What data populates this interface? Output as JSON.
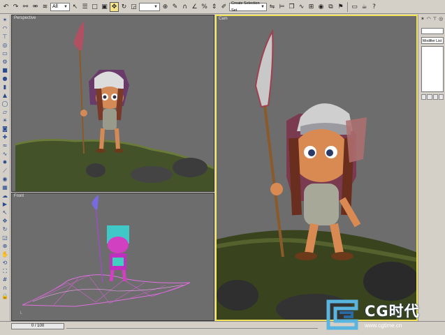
{
  "toolbar": {
    "selection_filter": "All",
    "named_selection": "Create Selection Set",
    "icons": [
      "undo-icon",
      "redo-icon",
      "link-icon",
      "unlink-icon",
      "bind-spacewarp-icon",
      "selection-filter",
      "select-object-icon",
      "select-by-name-icon",
      "rect-region-icon",
      "window-crossing-icon",
      "select-move-icon",
      "select-rotate-icon",
      "select-scale-icon",
      "reference-coord",
      "pivot-icon",
      "manipulate-icon",
      "snap-icon",
      "angle-snap-icon",
      "percent-snap-icon",
      "spinner-snap-icon",
      "named-selection",
      "mirror-icon",
      "align-icon",
      "layer-icon",
      "curve-editor-icon",
      "schematic-icon",
      "material-editor-icon",
      "render-scene-icon",
      "quick-render-icon",
      "render-type-icon",
      "teapot-icon"
    ]
  },
  "left_toolbar": {
    "icons": [
      "create-icon",
      "modify-icon",
      "hierarchy-icon",
      "motion-icon",
      "display-icon",
      "utilities-icon",
      "box-icon",
      "sphere-icon",
      "cylinder-icon",
      "cone-icon",
      "torus-icon",
      "plane-icon",
      "light-icon",
      "camera-icon",
      "helper-icon",
      "spacewarp-icon",
      "shape-icon",
      "particle-icon",
      "bone-icon",
      "material-icon",
      "render-icon",
      "environment-icon",
      "video-post-icon",
      "select-icon",
      "move-icon",
      "rotate-icon",
      "scale-icon",
      "zoom-icon",
      "pan-icon",
      "orbit-icon",
      "maximize-icon",
      "grid-icon",
      "snap-icon",
      "lock-icon"
    ]
  },
  "viewports": {
    "perspective": {
      "label": "Perspective"
    },
    "front": {
      "label": "Front"
    },
    "camera": {
      "label": "Cam"
    }
  },
  "command_panel": {
    "modifier_list": "Modifier List"
  },
  "timeline": {
    "frame": "0 / 100"
  },
  "watermark": {
    "brand": "CG时代",
    "url": "www.cgtime.cn"
  },
  "colors": {
    "viewport_bg": "#6d6d6d",
    "active_border": "#f2e35b",
    "wireframe": "#e070e0",
    "terrain": "#4a5a2a",
    "skin": "#d98a52"
  }
}
